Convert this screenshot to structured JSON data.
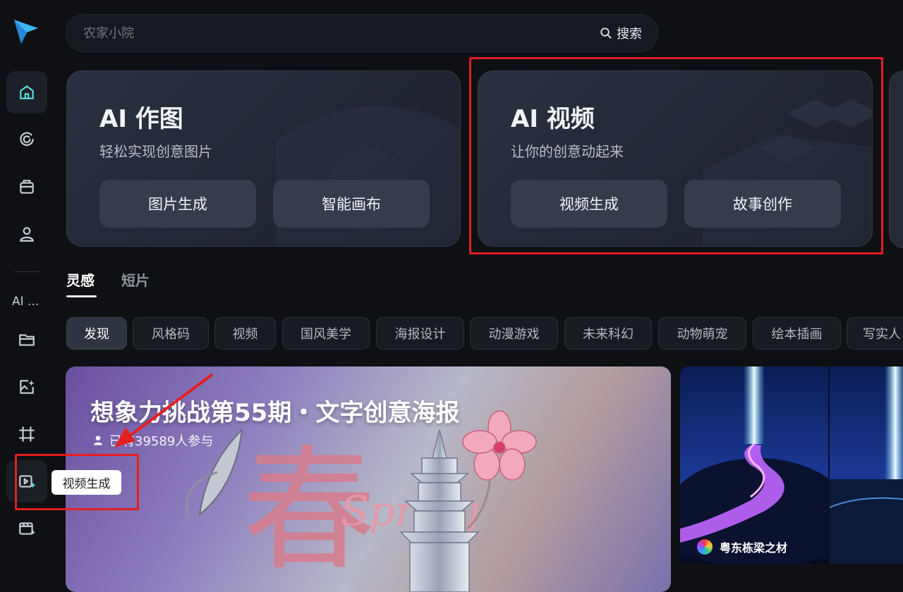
{
  "search": {
    "placeholder": "农家小院",
    "button_label": "搜索"
  },
  "sidebar": {
    "section_label": "AI ...",
    "tooltip": "视频生成",
    "items": [
      {
        "icon": "home-icon",
        "active": true
      },
      {
        "icon": "explore-icon"
      },
      {
        "icon": "toolbox-icon"
      },
      {
        "icon": "user-icon"
      },
      {
        "icon": "folder-icon"
      },
      {
        "icon": "image-edit-icon"
      },
      {
        "icon": "crop-icon"
      },
      {
        "icon": "video-generate-icon"
      },
      {
        "icon": "story-board-icon"
      }
    ]
  },
  "feature_cards": [
    {
      "title": "AI 作图",
      "subtitle": "轻松实现创意图片",
      "buttons": [
        "图片生成",
        "智能画布"
      ]
    },
    {
      "title": "AI 视频",
      "subtitle": "让你的创意动起来",
      "buttons": [
        "视频生成",
        "故事创作"
      ]
    }
  ],
  "tabs": [
    "灵感",
    "短片"
  ],
  "chips": [
    "发现",
    "风格码",
    "视频",
    "国风美学",
    "海报设计",
    "动漫游戏",
    "未来科幻",
    "动物萌宠",
    "绘本插画",
    "写实人"
  ],
  "banner": {
    "title": "想象力挑战第55期・文字创意海报",
    "participants": "已有39589人参与",
    "art_text_cn": "春",
    "art_text_en": "Spring"
  },
  "thumbnail": {
    "author": "粤东栋梁之材"
  },
  "colors": {
    "background": "#0e1014",
    "accent": "#5ce0e6",
    "annotation": "#e32020"
  }
}
